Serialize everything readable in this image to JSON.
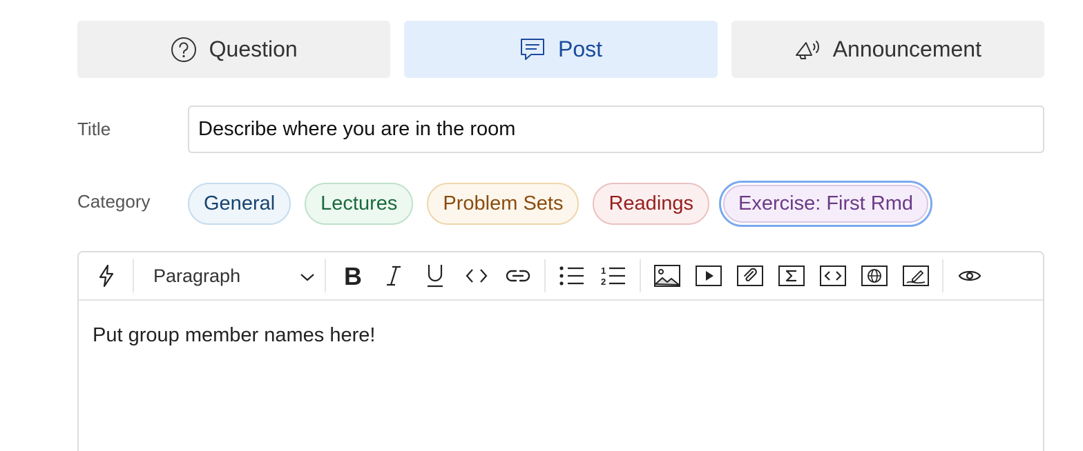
{
  "post_types": [
    {
      "label": "Question",
      "icon": "question-circle-icon",
      "active": false
    },
    {
      "label": "Post",
      "icon": "chat-bubble-icon",
      "active": true
    },
    {
      "label": "Announcement",
      "icon": "megaphone-icon",
      "active": false
    }
  ],
  "form": {
    "title_label": "Title",
    "title_value": "Describe where you are in the room",
    "category_label": "Category"
  },
  "categories": [
    {
      "label": "General",
      "color": "#16436e"
    },
    {
      "label": "Lectures",
      "color": "#1b6a3c"
    },
    {
      "label": "Problem Sets",
      "color": "#8a4c10"
    },
    {
      "label": "Readings",
      "color": "#951f1f"
    },
    {
      "label": "Exercise: First Rmd",
      "color": "#6c3a87",
      "selected": true
    }
  ],
  "editor": {
    "format_select": "Paragraph",
    "body": "Put group member names here!",
    "toolbar_icons": [
      "lightning-icon",
      "bold-icon",
      "italic-icon",
      "underline-icon",
      "inline-code-icon",
      "link-icon",
      "bullet-list-icon",
      "numbered-list-icon",
      "image-icon",
      "video-icon",
      "attachment-icon",
      "math-icon",
      "code-block-icon",
      "web-embed-icon",
      "drawing-icon",
      "preview-eye-icon"
    ]
  },
  "colors": {
    "accent": "#1a4b9b",
    "active_bg": "#e3eefd",
    "focus_ring": "#7aa9ee"
  }
}
